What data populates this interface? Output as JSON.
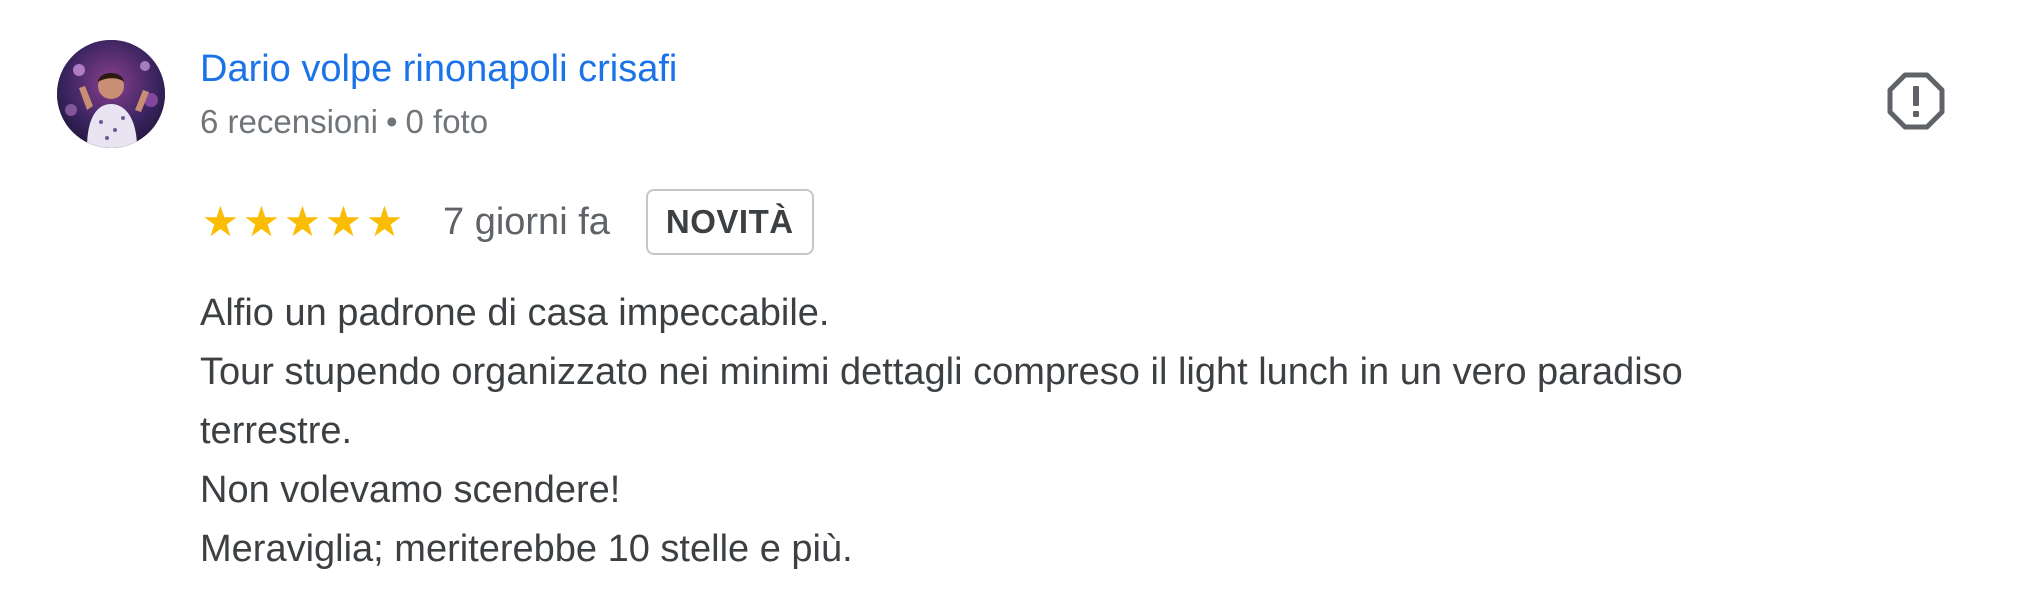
{
  "author": {
    "name": "Dario volpe rinonapoli crisafi",
    "reviews": "6 recensioni",
    "separator": "•",
    "photos": "0 foto"
  },
  "review": {
    "rating": 5,
    "max_rating": 5,
    "star_glyph": "★",
    "time": "7 giorni fa",
    "badge": "NOVITÀ",
    "lines": [
      "Alfio un padrone di casa impeccabile.",
      "Tour stupendo organizzato nei minimi dettagli compreso il light lunch in un vero paradiso",
      "terrestre.",
      "Non volevamo scendere!",
      "Meraviglia; meriterebbe 10 stelle e più."
    ]
  },
  "icons": {
    "avatar": "user-avatar-photo",
    "report": "report-flag-icon"
  },
  "colors": {
    "author_name": "#1a73e8",
    "meta_text": "#70757a",
    "star": "#fbbc04",
    "body_text": "#3c4043",
    "badge_border": "#c4c7c5",
    "report_icon": "#5f6368"
  }
}
